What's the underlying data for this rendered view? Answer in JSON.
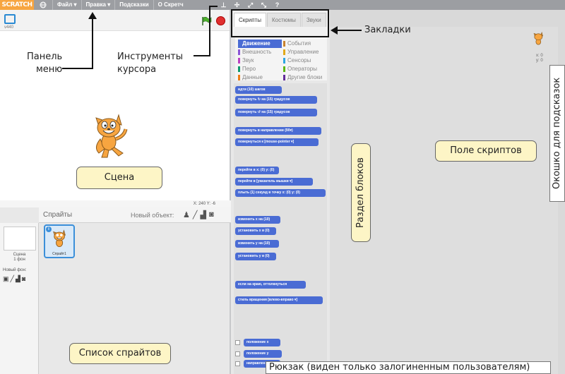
{
  "menu": {
    "logo": "SCRATCH",
    "items": [
      "Файл ▾",
      "Правка ▾",
      "Подсказки",
      "О Скретч"
    ]
  },
  "stage": {
    "version": "v440",
    "coords": "X: 240  Y: -6"
  },
  "sprites": {
    "title": "Спрайты",
    "new_object": "Новый объект:",
    "stage_label": "Сцена",
    "stage_backdrops": "1 фон",
    "new_backdrop": "Новый фон:",
    "sprite_name": "Спрайт1"
  },
  "tabs": [
    "Скрипты",
    "Костюмы",
    "Звуки"
  ],
  "categories": [
    {
      "label": "Движение",
      "color": "#4a6cd4",
      "active": true
    },
    {
      "label": "События",
      "color": "#c88330",
      "active": false
    },
    {
      "label": "Внешность",
      "color": "#8a55d7",
      "active": false
    },
    {
      "label": "Управление",
      "color": "#e1a91a",
      "active": false
    },
    {
      "label": "Звук",
      "color": "#bb42c3",
      "active": false
    },
    {
      "label": "Сенсоры",
      "color": "#2ca5e2",
      "active": false
    },
    {
      "label": "Перо",
      "color": "#0e9a6c",
      "active": false
    },
    {
      "label": "Операторы",
      "color": "#5cb712",
      "active": false
    },
    {
      "label": "Данные",
      "color": "#ee7d16",
      "active": false
    },
    {
      "label": "Другие блоки",
      "color": "#632d99",
      "active": false
    }
  ],
  "blocks": [
    "идти (10) шагов",
    "повернуть ↻ на (15) градусов",
    "повернуть ↺ на (15) градусов",
    "повернуть в направлении (90▾)",
    "повернуться к [mouse-pointer ▾]",
    "перейти в x: (0) y: (0)",
    "перейти в [указатель мышки ▾]",
    "плыть (1) секунд в точку x: (0) y: (0)",
    "изменить x на (10)",
    "установить x в (0)",
    "изменить y на (10)",
    "установить y в (0)",
    "если на краю, оттолкнуться",
    "стиль вращения [влево-вправо ▾]",
    "положение x",
    "положение y",
    "направление"
  ],
  "scripts_area": {
    "mini_x": "x: 0",
    "mini_y": "y: 0"
  },
  "annotations": {
    "menu_panel": "Панель\nменю",
    "cursor_tools": "Инструменты\nкурсора",
    "tabs": "Закладки",
    "stage": "Сцена",
    "sprite_list": "Список спрайтов",
    "blocks_section": "Раздел блоков",
    "scripts_field": "Поле скриптов",
    "tips_window": "Окошко для подсказок",
    "backpack": "Рюкзак (виден только залогиненным пользователям)"
  }
}
